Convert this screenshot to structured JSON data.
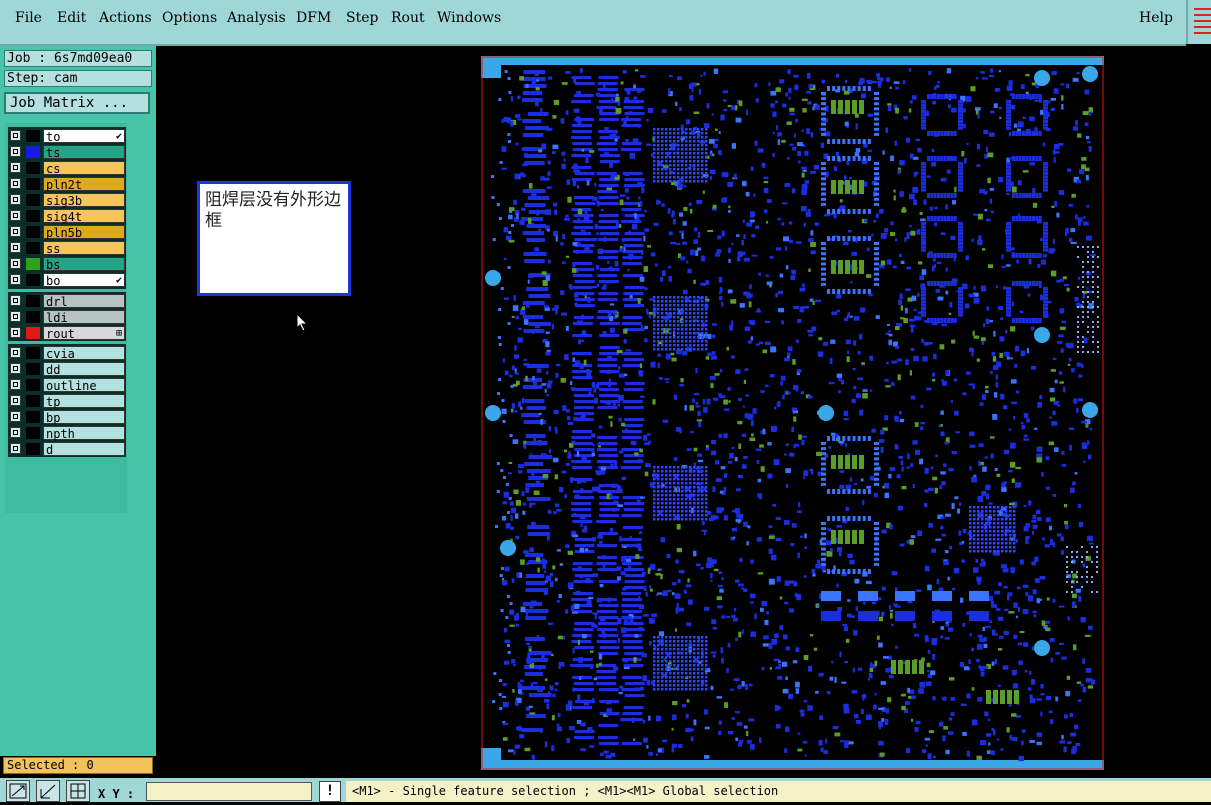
{
  "menubar": {
    "items": [
      "File",
      "Edit",
      "Actions",
      "Options",
      "Analysis",
      "DFM",
      "Step",
      "Rout",
      "Windows"
    ],
    "help": "Help"
  },
  "job": {
    "job_label": "Job : 6s7md09ea0",
    "step_label": "Step: cam",
    "matrix_button": "Job Matrix ..."
  },
  "layers": {
    "group1": [
      {
        "name": "to",
        "swatch": "#000000",
        "bg": "#ffffff",
        "mark": "✔"
      },
      {
        "name": "ts",
        "swatch": "#1a1ae6",
        "bg": "#22a586",
        "mark": ""
      },
      {
        "name": "cs",
        "swatch": "#000000",
        "bg": "#f5c45a",
        "mark": ""
      },
      {
        "name": "pln2t",
        "swatch": "#000000",
        "bg": "#ddaa1e",
        "mark": ""
      },
      {
        "name": "sig3b",
        "swatch": "#000000",
        "bg": "#f5c45a",
        "mark": ""
      },
      {
        "name": "sig4t",
        "swatch": "#000000",
        "bg": "#f5c45a",
        "mark": ""
      },
      {
        "name": "pln5b",
        "swatch": "#000000",
        "bg": "#ddaa1e",
        "mark": ""
      },
      {
        "name": "ss",
        "swatch": "#000000",
        "bg": "#f5c45a",
        "mark": ""
      },
      {
        "name": "bs",
        "swatch": "#2fa01a",
        "bg": "#22a586",
        "mark": ""
      },
      {
        "name": "bo",
        "swatch": "#000000",
        "bg": "#ffffff",
        "mark": "✔"
      }
    ],
    "group2": [
      {
        "name": "drl",
        "swatch": "#000000",
        "bg": "#b7c2c2",
        "mark": ""
      },
      {
        "name": "ldi",
        "swatch": "#000000",
        "bg": "#b7c2c2",
        "mark": ""
      },
      {
        "name": "rout",
        "swatch": "#e01818",
        "bg": "#d8d8d8",
        "mark": "⊞"
      }
    ],
    "group3": [
      {
        "name": "cvia",
        "swatch": "#000000",
        "bg": "#b5e0e0",
        "mark": ""
      },
      {
        "name": "dd",
        "swatch": "#000000",
        "bg": "#b5e0e0",
        "mark": ""
      },
      {
        "name": "outline",
        "swatch": "#000000",
        "bg": "#b5e0e0",
        "mark": ""
      },
      {
        "name": "tp",
        "swatch": "#000000",
        "bg": "#b5e0e0",
        "mark": ""
      },
      {
        "name": "bp",
        "swatch": "#000000",
        "bg": "#b5e0e0",
        "mark": ""
      },
      {
        "name": "npth",
        "swatch": "#000000",
        "bg": "#b5e0e0",
        "mark": ""
      },
      {
        "name": "d",
        "swatch": "#000000",
        "bg": "#b5e0e0",
        "mark": ""
      }
    ]
  },
  "note": {
    "text": "阻焊层没有外形边框"
  },
  "status": {
    "selected": "Selected : 0",
    "xy_label": "X Y :",
    "xy_value": "",
    "bang": "!",
    "hint": "<M1> - Single feature selection ; <M1><M1> Global selection"
  },
  "colors": {
    "board_blue": "#1a2ee0",
    "board_blue_light": "#3a74ff",
    "board_green": "#5a9e2a",
    "board_frame": "#3aa8e8",
    "profile": "#d81818"
  },
  "icons": [
    "zoom-fit-icon",
    "measure-icon",
    "grid-icon"
  ]
}
